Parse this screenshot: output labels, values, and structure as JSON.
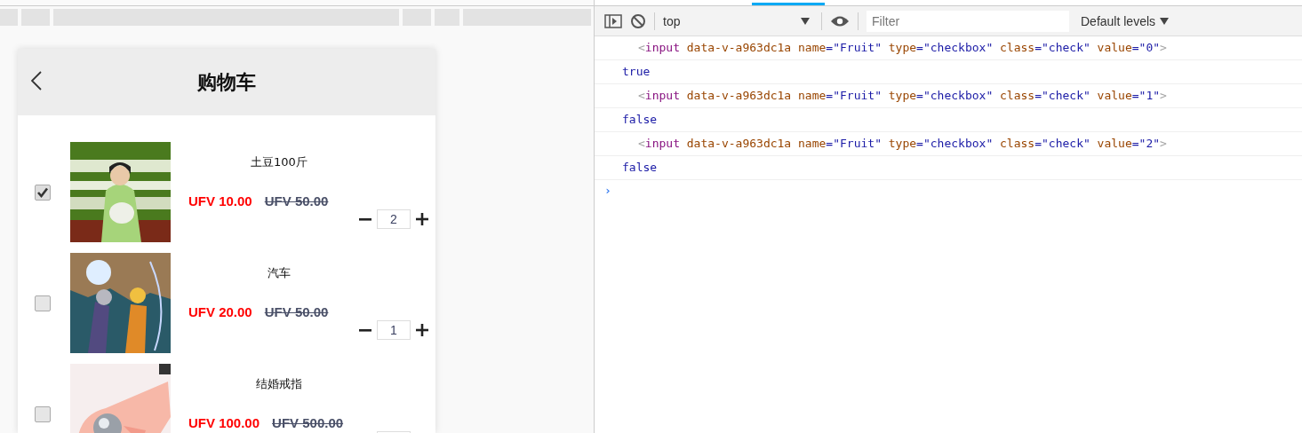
{
  "cart": {
    "title": "购物车",
    "items": [
      {
        "name": "土豆100斤",
        "price": "UFV 10.00",
        "old_price": "UFV 50.00",
        "quantity": "2",
        "checked": true
      },
      {
        "name": "汽车",
        "price": "UFV 20.00",
        "old_price": "UFV 50.00",
        "quantity": "1",
        "checked": false
      },
      {
        "name": "结婚戒指",
        "price": "UFV 100.00",
        "old_price": "UFV 500.00",
        "checked": false
      }
    ]
  },
  "devtools": {
    "context": "top",
    "filter_placeholder": "Filter",
    "levels": "Default levels",
    "console": [
      {
        "kind": "element",
        "parts": [
          {
            "text": "<",
            "kind": "punct"
          },
          {
            "text": "input",
            "kind": "tag"
          },
          {
            "text": " data-v-a963dc1a name",
            "kind": "attr"
          },
          {
            "text": "=\"Fruit\"",
            "kind": "val"
          },
          {
            "text": " type",
            "kind": "attr"
          },
          {
            "text": "=\"checkbox\"",
            "kind": "val"
          },
          {
            "text": " class",
            "kind": "attr"
          },
          {
            "text": "=\"check\"",
            "kind": "val"
          },
          {
            "text": " value",
            "kind": "attr"
          },
          {
            "text": "=\"0\"",
            "kind": "val"
          },
          {
            "text": ">",
            "kind": "punct"
          }
        ]
      },
      {
        "kind": "value",
        "parts": [
          {
            "text": "true",
            "kind": "bool"
          }
        ]
      },
      {
        "kind": "element",
        "parts": [
          {
            "text": "<",
            "kind": "punct"
          },
          {
            "text": "input",
            "kind": "tag"
          },
          {
            "text": " data-v-a963dc1a name",
            "kind": "attr"
          },
          {
            "text": "=\"Fruit\"",
            "kind": "val"
          },
          {
            "text": " type",
            "kind": "attr"
          },
          {
            "text": "=\"checkbox\"",
            "kind": "val"
          },
          {
            "text": " class",
            "kind": "attr"
          },
          {
            "text": "=\"check\"",
            "kind": "val"
          },
          {
            "text": " value",
            "kind": "attr"
          },
          {
            "text": "=\"1\"",
            "kind": "val"
          },
          {
            "text": ">",
            "kind": "punct"
          }
        ]
      },
      {
        "kind": "value",
        "parts": [
          {
            "text": "false",
            "kind": "bool"
          }
        ]
      },
      {
        "kind": "element",
        "parts": [
          {
            "text": "<",
            "kind": "punct"
          },
          {
            "text": "input",
            "kind": "tag"
          },
          {
            "text": " data-v-a963dc1a name",
            "kind": "attr"
          },
          {
            "text": "=\"Fruit\"",
            "kind": "val"
          },
          {
            "text": " type",
            "kind": "attr"
          },
          {
            "text": "=\"checkbox\"",
            "kind": "val"
          },
          {
            "text": " class",
            "kind": "attr"
          },
          {
            "text": "=\"check\"",
            "kind": "val"
          },
          {
            "text": " value",
            "kind": "attr"
          },
          {
            "text": "=\"2\"",
            "kind": "val"
          },
          {
            "text": ">",
            "kind": "punct"
          }
        ]
      },
      {
        "kind": "value",
        "parts": [
          {
            "text": "false",
            "kind": "bool"
          }
        ]
      }
    ],
    "prompt": "›"
  }
}
